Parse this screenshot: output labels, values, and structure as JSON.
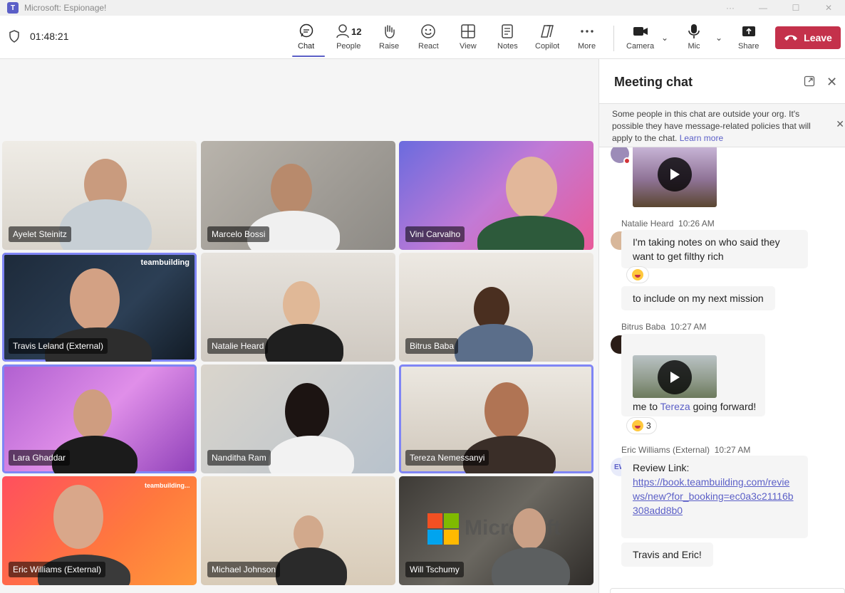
{
  "window": {
    "title": "Microsoft: Espionage!",
    "app_icon": "teams-icon"
  },
  "toolbar": {
    "timer": "01:48:21",
    "chat_label": "Chat",
    "people_label": "People",
    "people_count": "12",
    "raise_label": "Raise",
    "react_label": "React",
    "view_label": "View",
    "notes_label": "Notes",
    "copilot_label": "Copilot",
    "more_label": "More",
    "camera_label": "Camera",
    "mic_label": "Mic",
    "share_label": "Share",
    "leave_label": "Leave",
    "leave_color": "#c4314b",
    "accent_color": "#5b5fc7"
  },
  "participants": [
    {
      "name": "Ayelet Steinitz"
    },
    {
      "name": "Marcelo Bossi"
    },
    {
      "name": "Vini Carvalho"
    },
    {
      "name": "Travis Leland (External)"
    },
    {
      "name": "Natalie Heard"
    },
    {
      "name": "Bitrus Baba"
    },
    {
      "name": "Lara Ghaddar"
    },
    {
      "name": "Nanditha Ram"
    },
    {
      "name": "Tereza Nemessanyi"
    },
    {
      "name": "Eric Williams (External)"
    },
    {
      "name": "Michael Johnson"
    },
    {
      "name": "Will Tschumy"
    }
  ],
  "tile_brand": "teambuilding",
  "tile_brand_small": "teambuilding...",
  "background_text": "Microsoft",
  "chat": {
    "title": "Meeting chat",
    "notice": "Some people in this chat are outside your org. It's possible they have message-related policies that will apply to the chat.",
    "notice_link": "Learn more",
    "messages": [
      {
        "sender": "Natalie Heard",
        "time": "10:26 AM",
        "text1": "I'm taking notes on who said they want to get filthy rich",
        "text2": "to include on my next mission"
      },
      {
        "sender": "Bitrus Baba",
        "time": "10:27 AM",
        "text_before": "me to ",
        "mention": "Tereza",
        "text_after": " going forward!",
        "reaction_count": "3"
      },
      {
        "sender": "Eric Williams (External)",
        "time": "10:27 AM",
        "initials": "EW",
        "text_label": "Review Link:",
        "link": "https://book.teambuilding.com/reviews/new?for_booking=ec0a3c21116b308add8b0",
        "text2": "Travis and Eric!"
      }
    ]
  }
}
